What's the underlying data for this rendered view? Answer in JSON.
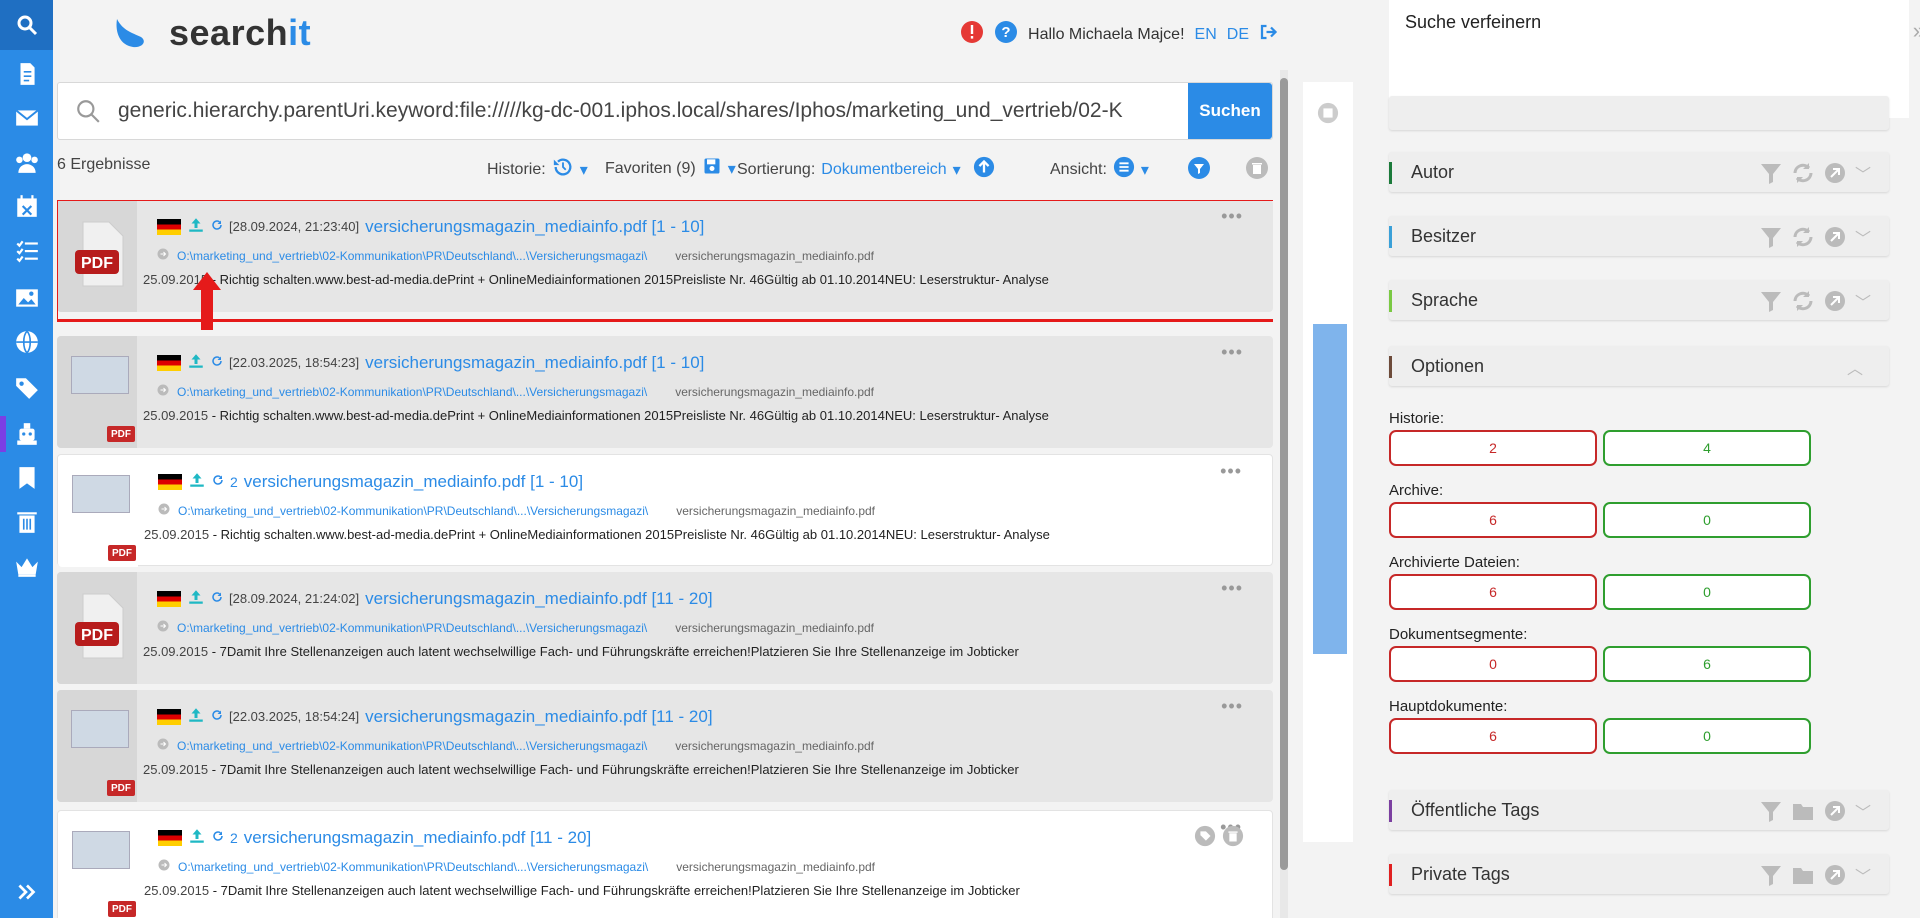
{
  "app": {
    "logo_text_a": "search",
    "logo_text_b": "it"
  },
  "header": {
    "greeting": "Hallo Michaela Majce!",
    "lang_en": "EN",
    "lang_de": "DE"
  },
  "search": {
    "query": "generic.hierarchy.parentUri.keyword:file://///kg-dc-001.iphos.local/shares/Iphos/marketing_und_vertrieb/02-K",
    "button": "Suchen"
  },
  "toolbar": {
    "result_count": "6 Ergebnisse",
    "history_label": "Historie:",
    "favorites_label": "Favoriten (9)",
    "sort_label": "Sortierung:",
    "sort_value": "Dokumentbereich",
    "view_label": "Ansicht:"
  },
  "results": [
    {
      "timestamp": "[28.09.2024, 21:23:40]",
      "title": "versicherungsmagazin_mediainfo.pdf [1 - 10]",
      "path": "O:\\marketing_und_vertrieb\\02-Kommunikation\\PR\\Deutschland\\...\\Versicherungsmagazi\\",
      "filename": "versicherungsmagazin_mediainfo.pdf",
      "date": "25.09.2015",
      "snippet": "Richtig schalten.www.best-ad-media.dePrint + OnlineMediainformationen 2015Preisliste Nr. 46Gültig ab 01.10.2014NEU: Leserstruktur- Analyse",
      "prefix": ""
    },
    {
      "timestamp": "[22.03.2025, 18:54:23]",
      "title": "versicherungsmagazin_mediainfo.pdf [1 - 10]",
      "path": "O:\\marketing_und_vertrieb\\02-Kommunikation\\PR\\Deutschland\\...\\Versicherungsmagazi\\",
      "filename": "versicherungsmagazin_mediainfo.pdf",
      "date": "25.09.2015",
      "snippet": "Richtig schalten.www.best-ad-media.dePrint + OnlineMediainformationen 2015Preisliste Nr. 46Gültig ab 01.10.2014NEU: Leserstruktur- Analyse",
      "prefix": ""
    },
    {
      "timestamp": "2",
      "title": "versicherungsmagazin_mediainfo.pdf [1 - 10]",
      "path": "O:\\marketing_und_vertrieb\\02-Kommunikation\\PR\\Deutschland\\...\\Versicherungsmagazi\\",
      "filename": "versicherungsmagazin_mediainfo.pdf",
      "date": "25.09.2015",
      "snippet": "Richtig schalten.www.best-ad-media.dePrint + OnlineMediainformationen 2015Preisliste Nr. 46Gültig ab 01.10.2014NEU: Leserstruktur- Analyse",
      "prefix": ""
    },
    {
      "timestamp": "[28.09.2024, 21:24:02]",
      "title": "versicherungsmagazin_mediainfo.pdf [11 - 20]",
      "path": "O:\\marketing_und_vertrieb\\02-Kommunikation\\PR\\Deutschland\\...\\Versicherungsmagazi\\",
      "filename": "versicherungsmagazin_mediainfo.pdf",
      "date": "25.09.2015",
      "snippet": "7Damit Ihre Stellenanzeigen auch latent wechselwillige Fach- und Führungskräfte erreichen!Platzieren Sie Ihre Stellenanzeige im Jobticker",
      "prefix": ""
    },
    {
      "timestamp": "[22.03.2025, 18:54:24]",
      "title": "versicherungsmagazin_mediainfo.pdf [11 - 20]",
      "path": "O:\\marketing_und_vertrieb\\02-Kommunikation\\PR\\Deutschland\\...\\Versicherungsmagazi\\",
      "filename": "versicherungsmagazin_mediainfo.pdf",
      "date": "25.09.2015",
      "snippet": "7Damit Ihre Stellenanzeigen auch latent wechselwillige Fach- und Führungskräfte erreichen!Platzieren Sie Ihre Stellenanzeige im Jobticker",
      "prefix": ""
    },
    {
      "timestamp": "2",
      "title": "versicherungsmagazin_mediainfo.pdf [11 - 20]",
      "path": "O:\\marketing_und_vertrieb\\02-Kommunikation\\PR\\Deutschland\\...\\Versicherungsmagazi\\",
      "filename": "versicherungsmagazin_mediainfo.pdf",
      "date": "25.09.2015",
      "snippet": "7Damit Ihre Stellenanzeigen auch latent wechselwillige Fach- und Führungskräfte erreichen!Platzieren Sie Ihre Stellenanzeige im Jobticker",
      "prefix": ""
    }
  ],
  "pdf_label": "PDF",
  "sidebar": {
    "refine_title": "Suche verfeinern",
    "facets": [
      {
        "label": "Autor",
        "color": "#1b7a3a"
      },
      {
        "label": "Besitzer",
        "color": "#3aa0d8"
      },
      {
        "label": "Sprache",
        "color": "#7ac943"
      },
      {
        "label": "Optionen",
        "color": "#6d4b3a"
      },
      {
        "label": "Öffentliche Tags",
        "color": "#7b3fa0"
      },
      {
        "label": "Private Tags",
        "color": "#e02020"
      }
    ],
    "options": [
      {
        "label": "Historie:",
        "red": "2",
        "green": "4"
      },
      {
        "label": "Archive:",
        "red": "6",
        "green": "0"
      },
      {
        "label": "Archivierte Dateien:",
        "red": "6",
        "green": "0"
      },
      {
        "label": "Dokumentsegmente:",
        "red": "0",
        "green": "6"
      },
      {
        "label": "Hauptdokumente:",
        "red": "6",
        "green": "0"
      }
    ]
  },
  "colors": {
    "accent": "#2b8be6",
    "red": "#c62828",
    "green": "#2e9e2e"
  },
  "icons": [
    "search-icon",
    "document-icon",
    "mail-icon",
    "users-icon",
    "calendar-icon",
    "list-icon",
    "image-icon",
    "globe-icon",
    "tags-icon",
    "robot-icon",
    "bookmark-icon",
    "trash-icon",
    "crown-icon"
  ]
}
